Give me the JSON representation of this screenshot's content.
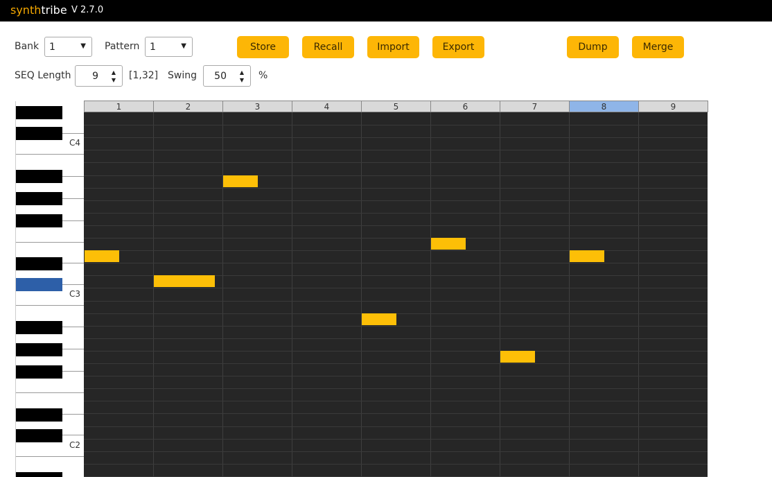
{
  "app": {
    "brand_part1": "synth",
    "brand_part2": "tribe",
    "version": "V 2.7.0"
  },
  "controls": {
    "bank_label": "Bank",
    "bank_value": "1",
    "pattern_label": "Pattern",
    "pattern_value": "1",
    "seq_length_label": "SEQ Length",
    "seq_length_value": "9",
    "seq_length_range": "[1,32]",
    "swing_label": "Swing",
    "swing_value": "50",
    "swing_unit": "%"
  },
  "buttons": {
    "store": "Store",
    "recall": "Recall",
    "import": "Import",
    "export": "Export",
    "dump": "Dump",
    "merge": "Merge"
  },
  "icons": {
    "dropdown": "▼",
    "spin_up": "▲",
    "spin_down": "▼"
  },
  "colors": {
    "accent": "#fdb606",
    "note": "#fdbf07",
    "selected_step": "#8fb5e8",
    "active_key": "#2d5fa8",
    "grid_bg": "#262626"
  },
  "steps": [
    "1",
    "2",
    "3",
    "4",
    "5",
    "6",
    "7",
    "8",
    "9"
  ],
  "selected_step": 8,
  "keyboard": {
    "octave_labels": [
      "C4",
      "C3",
      "C2"
    ]
  },
  "notes": [
    {
      "step": 1,
      "row": 11,
      "length": 0.5
    },
    {
      "step": 2,
      "row": 13,
      "length": 0.88
    },
    {
      "step": 3,
      "row": 5,
      "length": 0.5
    },
    {
      "step": 5,
      "row": 16,
      "length": 0.5
    },
    {
      "step": 6,
      "row": 10,
      "length": 0.5
    },
    {
      "step": 7,
      "row": 19,
      "length": 0.5
    },
    {
      "step": 8,
      "row": 11,
      "length": 0.5
    }
  ]
}
